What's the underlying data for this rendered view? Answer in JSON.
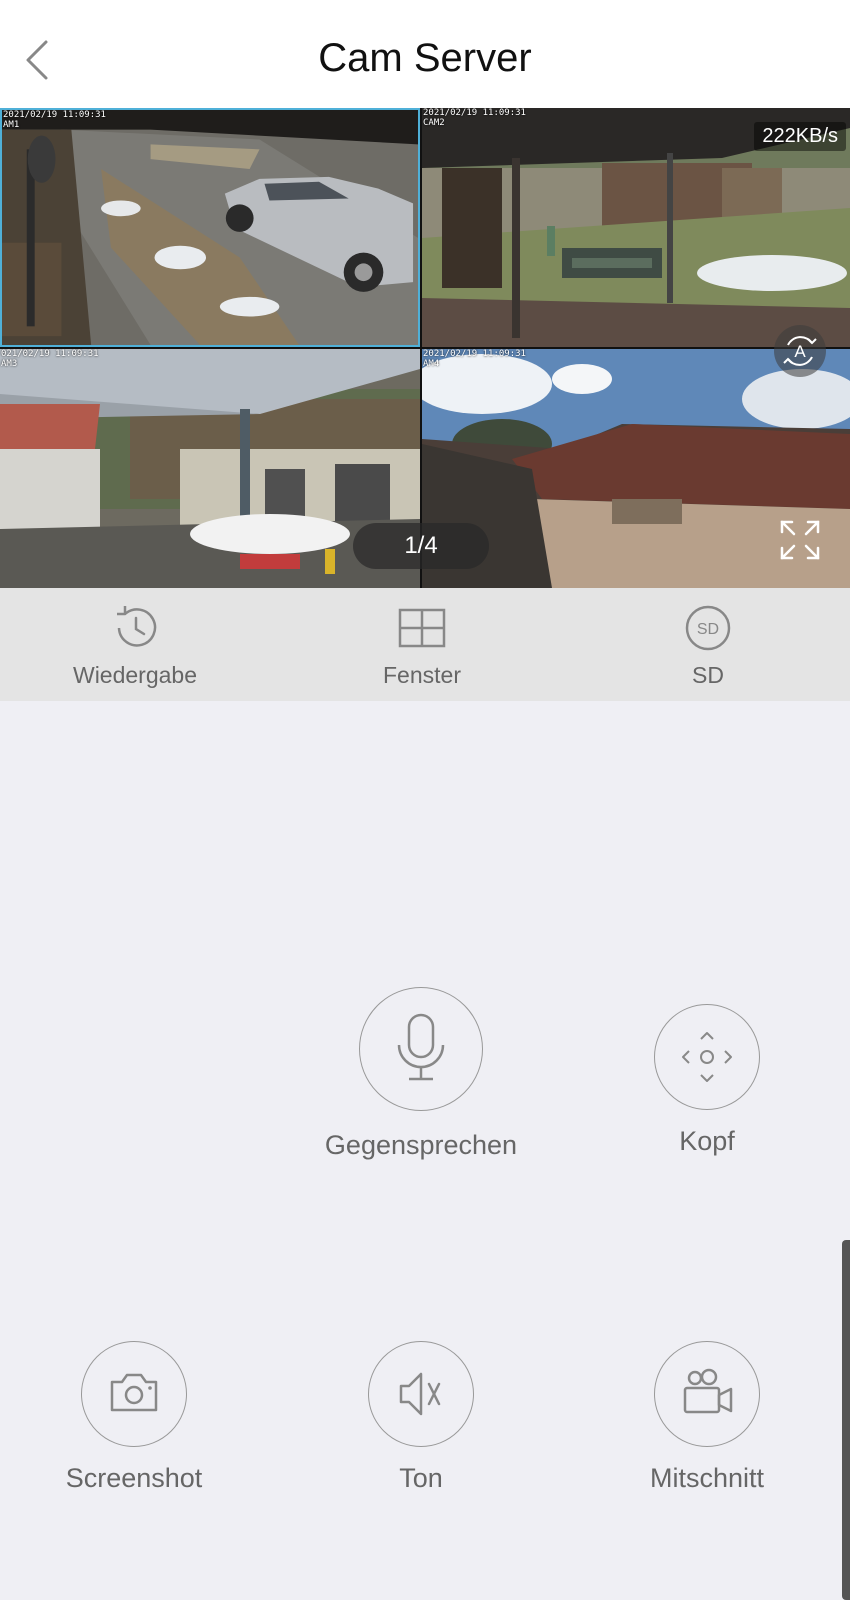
{
  "header": {
    "title": "Cam Server",
    "back_icon": "chevron-left-icon"
  },
  "video": {
    "bitrate": "222KB/s",
    "page_indicator": "1/4",
    "cameras": [
      {
        "timestamp": "2021/02/19 11:09:31",
        "name": "AM1"
      },
      {
        "timestamp": "2021/02/19 11:09:31",
        "name": "CAM2"
      },
      {
        "timestamp": "021/02/19 11:09:31",
        "name": "AM3"
      },
      {
        "timestamp": "2021/02/19 11:09:31",
        "name": "AM4"
      }
    ],
    "selected_color": "#4fb0d8"
  },
  "toolbar": {
    "items": [
      {
        "label": "Wiedergabe",
        "icon": "history-icon"
      },
      {
        "label": "Fenster",
        "icon": "grid-icon"
      },
      {
        "label": "SD",
        "icon": "sd-quality-icon"
      }
    ]
  },
  "controls": {
    "talk": {
      "label": "Gegensprechen",
      "icon": "microphone-icon"
    },
    "ptz": {
      "label": "Kopf",
      "icon": "ptz-direction-icon"
    },
    "screenshot": {
      "label": "Screenshot",
      "icon": "camera-icon"
    },
    "sound": {
      "label": "Ton",
      "icon": "speaker-mute-icon"
    },
    "record": {
      "label": "Mitschnitt",
      "icon": "video-record-icon"
    }
  },
  "colors": {
    "background": "#efeff4",
    "toolbar": "#e4e4e4",
    "icon": "#888888"
  }
}
